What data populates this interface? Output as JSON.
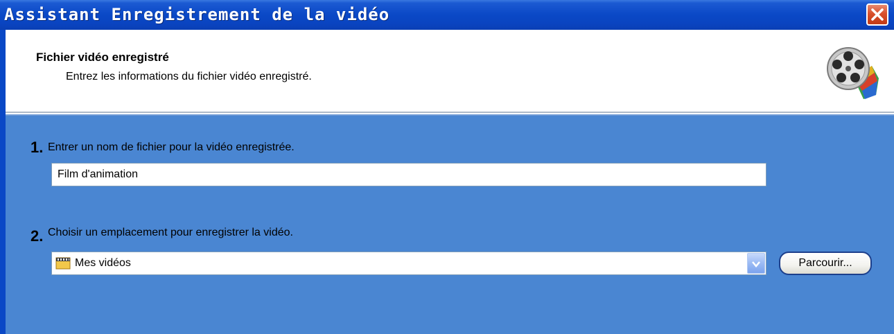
{
  "window": {
    "title": "Assistant Enregistrement de la vidéo",
    "close_icon": "close-x-icon"
  },
  "header": {
    "title": "Fichier vidéo enregistré",
    "subtitle": "Entrez les informations du fichier vidéo enregistré.",
    "icon": "film-reel-icon"
  },
  "steps": [
    {
      "number": "1.",
      "label": "Entrer un nom de fichier pour la vidéo enregistrée.",
      "input_value": "Film d'animation"
    },
    {
      "number": "2.",
      "label": "Choisir un emplacement pour enregistrer la vidéo.",
      "selected_location": "Mes vidéos",
      "location_icon": "folder-icon",
      "browse_label": "Parcourir..."
    }
  ],
  "colors": {
    "title_bar": "#0a48c6",
    "body_background": "#4a86d2",
    "close_button": "#d8502c"
  }
}
